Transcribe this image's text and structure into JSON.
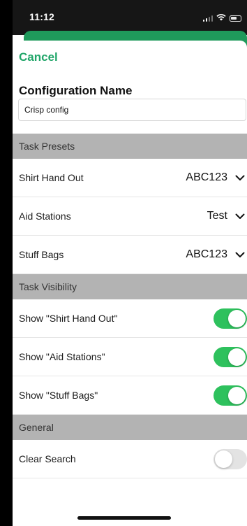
{
  "status_bar": {
    "time": "11:12"
  },
  "header": {
    "cancel_label": "Cancel"
  },
  "configuration": {
    "label": "Configuration Name",
    "value": "Crisp config"
  },
  "task_presets": {
    "title": "Task Presets",
    "items": [
      {
        "label": "Shirt Hand Out",
        "value": "ABC123"
      },
      {
        "label": "Aid Stations",
        "value": "Test"
      },
      {
        "label": "Stuff Bags",
        "value": "ABC123"
      }
    ]
  },
  "task_visibility": {
    "title": "Task Visibility",
    "items": [
      {
        "label": "Show \"Shirt Hand Out\"",
        "enabled": true
      },
      {
        "label": "Show \"Aid Stations\"",
        "enabled": true
      },
      {
        "label": "Show \"Stuff Bags\"",
        "enabled": true
      }
    ]
  },
  "general": {
    "title": "General",
    "items": [
      {
        "label": "Clear Search",
        "enabled": false
      }
    ]
  },
  "colors": {
    "accent": "#22a66a",
    "toggle_on": "#2ec15d",
    "toggle_off": "#e3e3e3",
    "section_bg": "#b3b3b3"
  }
}
